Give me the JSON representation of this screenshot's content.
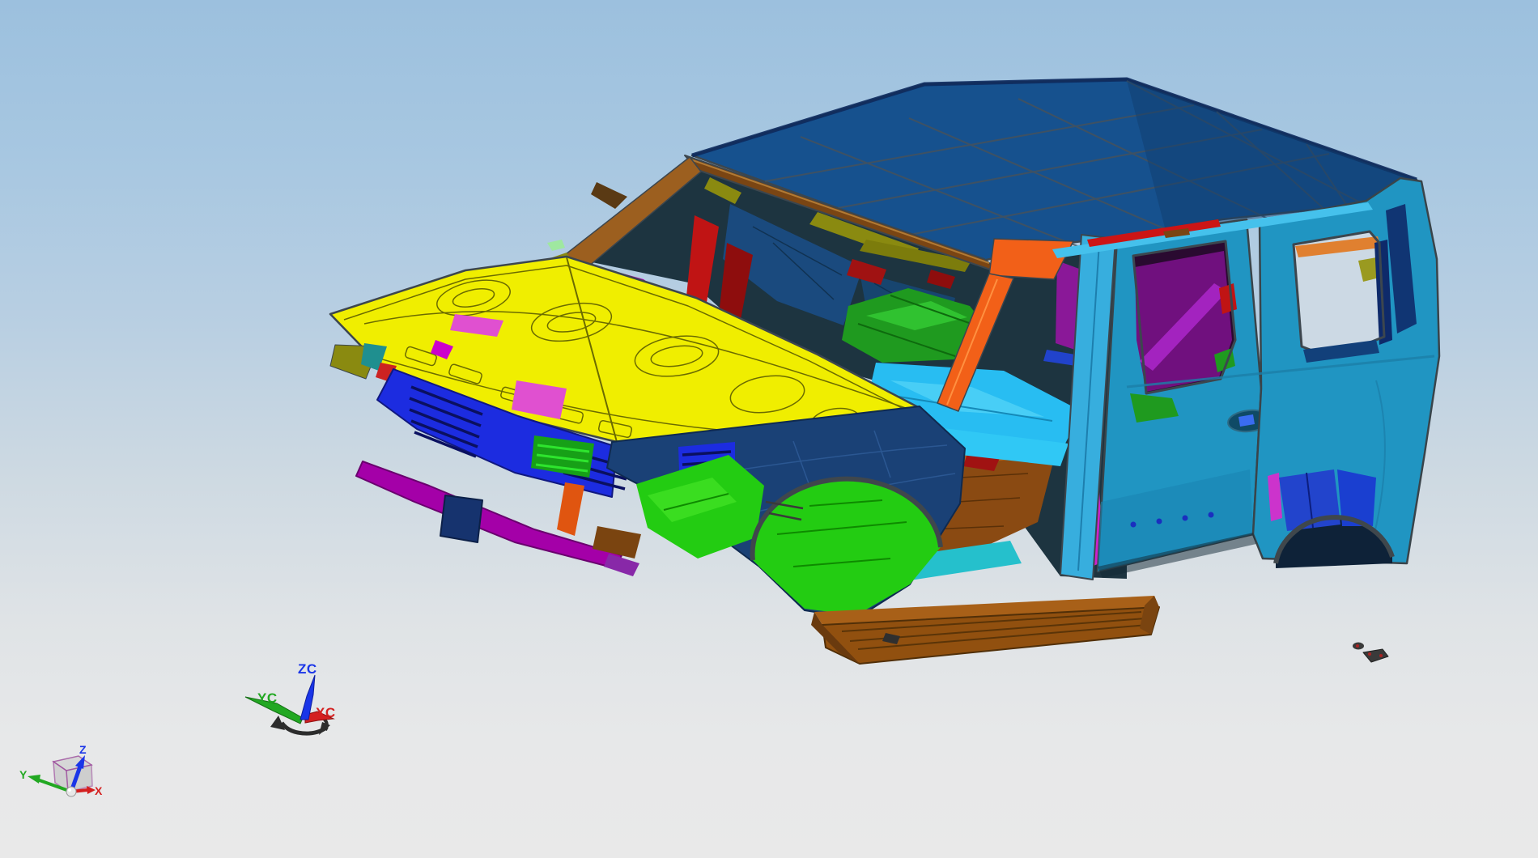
{
  "app": {
    "name": "CAD 3D viewport",
    "content": "SUV body-in-white assembly, front-left isometric view"
  },
  "viewport": {
    "background_top": "#9cc0de",
    "background_bottom": "#e9e9e9"
  },
  "palette": {
    "outline": "#4a5156",
    "roof_blue": "#16518e",
    "roof_edge_navy": "#0d2a5e",
    "header_brown": "#7a4513",
    "apillar_brown": "#9c5f1f",
    "hood_yellow": "#f0ee00",
    "hood_shade": "#d8d400",
    "body_teal": "#2095c2",
    "pillar_cyan": "#37aede",
    "drip_cyan": "#45c1ec",
    "drip_red": "#cc1515",
    "pillar_orange": "#f26018",
    "bpillar_green": "#2fbf2f",
    "bpillar_magenta": "#cc22cc",
    "seatback_purple": "#70107e",
    "seatback_tube": "#a826c6",
    "dpillar_navy": "#0e2a6a",
    "wheelhouse_blue": "#2244cc",
    "fender_navy": "#1a4176",
    "radiator_blue": "#1c2ce0",
    "bumper_magenta": "#a400a8",
    "floor_green": "#23cc12",
    "seat_green": "#1f9a1f",
    "floor_cyan": "#28bdf2",
    "rocker_cyan": "#25c0cc",
    "interior_brown": "#8a4a12",
    "rocker_brown": "#91500f",
    "olive": "#8a8a10",
    "dark_red": "#a01212",
    "interior_navy": "#1a4a7e",
    "interior_dark": "#1d3440",
    "pink": "#e050d0",
    "gold": "#c8a010",
    "window_seethrough": "#ccd9e4",
    "axis_blue": "#1a35e8",
    "axis_green": "#22a822",
    "axis_red": "#d42020",
    "cube_edge": "#9a4a9a"
  },
  "model": {
    "name": "suv-body-in-white",
    "parts": [
      {
        "name": "roof-panel",
        "color": "#16518e"
      },
      {
        "name": "windshield-header-rail",
        "color": "#7a4513"
      },
      {
        "name": "a-pillar-far-rail",
        "color": "#9c5f1f"
      },
      {
        "name": "hood-inner-panel",
        "color": "#f0ee00"
      },
      {
        "name": "body-side-outer",
        "color": "#2095c2"
      },
      {
        "name": "b-pillar-outer",
        "color": "#37aede"
      },
      {
        "name": "a-pillar-near",
        "color": "#f26018"
      },
      {
        "name": "roof-drip-rail",
        "color": "#45c1ec"
      },
      {
        "name": "front-floor-pan",
        "color": "#23cc12"
      },
      {
        "name": "cabin-floor",
        "color": "#28bdf2"
      },
      {
        "name": "rear-seat-back-panel",
        "color": "#70107e"
      },
      {
        "name": "front-bumper-beam",
        "color": "#a400a8"
      },
      {
        "name": "radiator-support",
        "color": "#1c2ce0"
      },
      {
        "name": "front-fender-apron",
        "color": "#1a4176"
      },
      {
        "name": "rocker-step",
        "color": "#91500f"
      },
      {
        "name": "mid-floor",
        "color": "#8a4a12"
      },
      {
        "name": "seat-frame",
        "color": "#1f9a1f"
      },
      {
        "name": "d-pillar-inner",
        "color": "#0e2a6a"
      },
      {
        "name": "rear-wheelhouse",
        "color": "#2244cc"
      },
      {
        "name": "loose-bracket",
        "color": "#3a3a3a"
      }
    ]
  },
  "wcs_triad": {
    "z_label": "ZC",
    "y_label": "YC",
    "x_label": "XC",
    "z_color": "#1a35e8",
    "y_color": "#22a822",
    "x_color": "#d42020"
  },
  "view_triad": {
    "z_label": "Z",
    "y_label": "Y",
    "x_label": "X",
    "z_color": "#1a35e8",
    "y_color": "#22a822",
    "x_color": "#d42020"
  }
}
